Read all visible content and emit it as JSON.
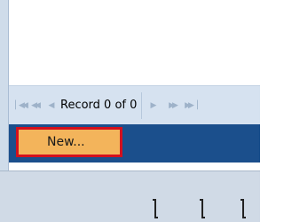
{
  "navigation": {
    "first_icon": "first-record-icon",
    "prev_page_icon": "previous-page-icon",
    "prev_icon": "previous-record-icon",
    "record_label": "Record 0 of 0",
    "next_icon": "next-record-icon",
    "next_page_icon": "next-page-icon",
    "last_icon": "last-record-icon"
  },
  "toolbar": {
    "new_label": "New..."
  },
  "colors": {
    "nav_bar": "#d6e2f0",
    "strip": "#1b4f8c",
    "new_button": "#f3b45b",
    "highlight": "#d3101d"
  }
}
